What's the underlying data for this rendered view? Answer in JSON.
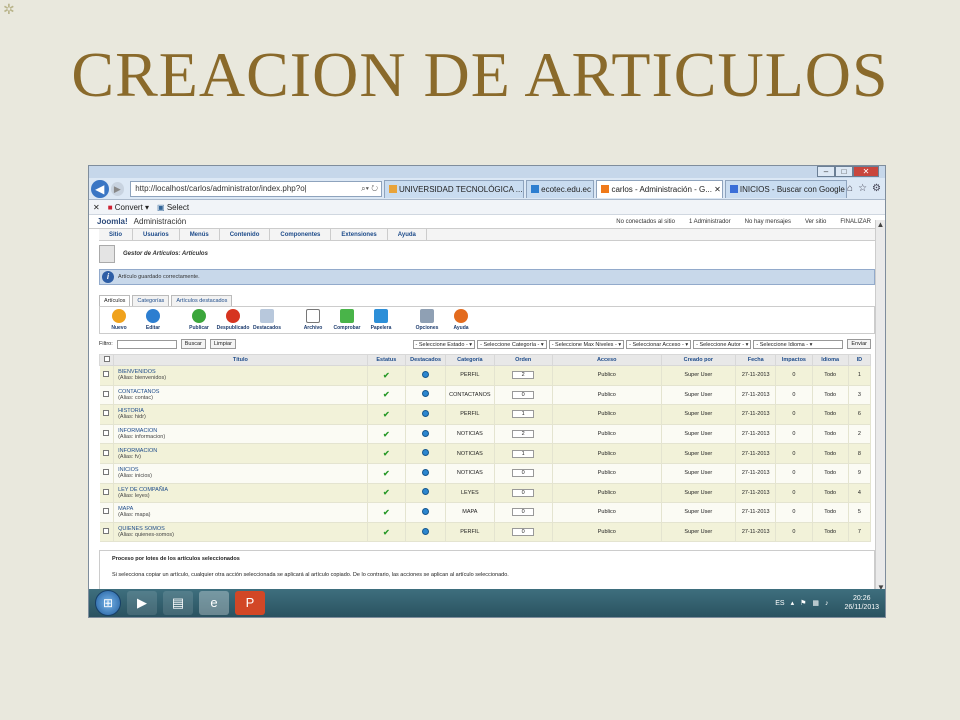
{
  "slide": {
    "title": "CREACION DE ARTICULOS"
  },
  "browser": {
    "address": "http://localhost/carlos/administrator/index.php?o|",
    "tabs": [
      {
        "label": "UNIVERSIDAD TECNOLÓGICA ..."
      },
      {
        "label": "ecotec.edu.ec"
      },
      {
        "label": "carlos - Administración - G..."
      },
      {
        "label": "INICIOS - Buscar con Google"
      }
    ],
    "command_bar": {
      "convert": "Convert",
      "select": "Select"
    }
  },
  "joomla": {
    "logo": "Joomla!",
    "admin_label": "Administración",
    "status": {
      "not_connected": "No conectados al sitio",
      "administrators": "1 Administrador",
      "no_messages": "No hay mensajes",
      "view_site": "Ver sitio",
      "logout": "FINALIZAR"
    },
    "menu": [
      "Sitio",
      "Usuarios",
      "Menús",
      "Contenido",
      "Componentes",
      "Extensiones",
      "Ayuda"
    ],
    "page_title": "Gestor de Artículos: Artículos",
    "message": "Artículo guardado correctamente.",
    "subtabs": [
      "Artículos",
      "Categorías",
      "Artículos destacados"
    ],
    "toolbar": [
      "Nuevo",
      "Editar",
      "Publicar",
      "Despublicado",
      "Destacados",
      "Archivo",
      "Comprobar",
      "Papelera",
      "Opciones",
      "Ayuda"
    ],
    "filter": {
      "label": "Filtro:",
      "search_button": "Buscar",
      "clear_button": "Limpiar",
      "selects": [
        "- Seleccione Estado -",
        "- Seleccione Categoría -",
        "- Seleccione Max Niveles -",
        "- Seleccionar Acceso -",
        "- Seleccione Autor -",
        "- Seleccione Idioma -"
      ],
      "send_button": "Enviar"
    },
    "table": {
      "headers": [
        "Título",
        "Estatus",
        "Destacados",
        "Categoría",
        "Orden",
        "Acceso",
        "Creado por",
        "Fecha",
        "Impactos",
        "Idioma",
        "ID"
      ],
      "rows": [
        {
          "title": "BIENVENIDOS",
          "alias": "(Alias: bienvenidos)",
          "category": "PERFIL",
          "order": "2",
          "access": "Publico",
          "author": "Super User",
          "date": "27-11-2013",
          "hits": "0",
          "language": "Todo",
          "id": "1"
        },
        {
          "title": "CONTACTANOS",
          "alias": "(Alias: contac)",
          "category": "CONTACTANOS",
          "order": "0",
          "access": "Publico",
          "author": "Super User",
          "date": "27-11-2013",
          "hits": "0",
          "language": "Todo",
          "id": "3"
        },
        {
          "title": "HISTORIA",
          "alias": "(Alias: hidr)",
          "category": "PERFIL",
          "order": "1",
          "access": "Publico",
          "author": "Super User",
          "date": "27-11-2013",
          "hits": "0",
          "language": "Todo",
          "id": "6"
        },
        {
          "title": "INFORMACION",
          "alias": "(Alias: informacion)",
          "category": "NOTICIAS",
          "order": "2",
          "access": "Publico",
          "author": "Super User",
          "date": "27-11-2013",
          "hits": "0",
          "language": "Todo",
          "id": "2"
        },
        {
          "title": "INFORMACION",
          "alias": "(Alias: fv)",
          "category": "NOTICIAS",
          "order": "1",
          "access": "Publico",
          "author": "Super User",
          "date": "27-11-2013",
          "hits": "0",
          "language": "Todo",
          "id": "8"
        },
        {
          "title": "INICIOS",
          "alias": "(Alias: inicios)",
          "category": "NOTICIAS",
          "order": "0",
          "access": "Publico",
          "author": "Super User",
          "date": "27-11-2013",
          "hits": "0",
          "language": "Todo",
          "id": "9"
        },
        {
          "title": "LEY DE COMPAÑIA",
          "alias": "(Alias: leyes)",
          "category": "LEYES",
          "order": "0",
          "access": "Publico",
          "author": "Super User",
          "date": "27-11-2013",
          "hits": "0",
          "language": "Todo",
          "id": "4"
        },
        {
          "title": "MAPA",
          "alias": "(Alias: mapa)",
          "category": "MAPA",
          "order": "0",
          "access": "Publico",
          "author": "Super User",
          "date": "27-11-2013",
          "hits": "0",
          "language": "Todo",
          "id": "5"
        },
        {
          "title": "QUIENES SOMOS",
          "alias": "(Alias: quienes-somos)",
          "category": "PERFIL",
          "order": "0",
          "access": "Publico",
          "author": "Super User",
          "date": "27-11-2013",
          "hits": "0",
          "language": "Todo",
          "id": "7"
        }
      ]
    },
    "batch": {
      "heading": "Proceso por lotes de los artículos seleccionados",
      "text": "Si selecciona copiar un artículo, cualquier otra acción seleccionada se aplicará al artículo copiado. De lo contrario, las acciones se aplican al artículo seleccionado."
    }
  },
  "taskbar": {
    "language": "ES",
    "time": "20:26",
    "date": "26/11/2013"
  },
  "colors": {
    "title": "#8a6a2b",
    "slide_bg": "#e9e8dd",
    "link": "#1d4b8a",
    "row_alt": "#f2f2d9"
  }
}
